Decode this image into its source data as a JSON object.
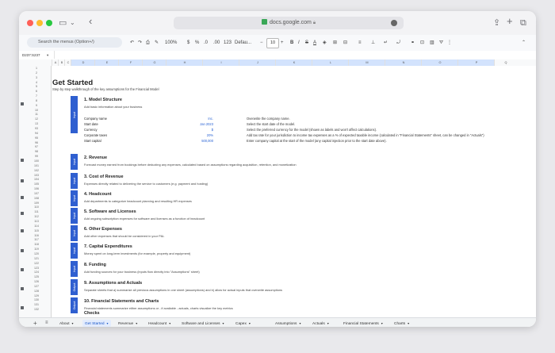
{
  "browser": {
    "url": "docs.google.com",
    "traffic_colors": {
      "close": "#ff5f57",
      "minimize": "#febc2e",
      "zoom": "#28c840"
    }
  },
  "toolbar": {
    "search_placeholder": "Search the menus (Option+/)",
    "zoom": "100%",
    "currency": "$",
    "percent": "%",
    "decimal_decrease": ".0",
    "decimal_increase": ".00",
    "number_format": "123",
    "font": "Defau...",
    "font_size": "10"
  },
  "formula_bar": {
    "name_box": "D237:S237"
  },
  "columns": [
    "A",
    "B",
    "C",
    "D",
    "E",
    "F",
    "G",
    "H",
    "I",
    "J",
    "K",
    "L",
    "M",
    "N",
    "O",
    "P",
    "Q"
  ],
  "rows": [
    "1",
    "2",
    "3",
    "4",
    "5",
    "6",
    "7",
    "8",
    "9",
    "10",
    "11",
    "12",
    "13",
    "93",
    "94",
    "95",
    "96",
    "97",
    "98",
    "99",
    "100",
    "101",
    "102",
    "103",
    "104",
    "105",
    "106",
    "107",
    "108",
    "109",
    "110",
    "111",
    "112",
    "113",
    "114",
    "115",
    "116",
    "117",
    "118",
    "119",
    "120",
    "121",
    "122",
    "123",
    "124",
    "125",
    "126",
    "127",
    "128",
    "129",
    "130",
    "131",
    "132"
  ],
  "sheet": {
    "title": "Get Started",
    "subtitle": "Step by step walkthrough of the key assumptions for the Financial Model",
    "input_tag": "Input",
    "output_tag": "Output",
    "sections": [
      {
        "title": "1. Model Structure",
        "desc": "Add basic information about your business",
        "tag": "Input"
      },
      {
        "title": "2. Revenue",
        "desc": "Forecast money earned from bookings before deducting any expenses, calculated based on assumptions regarding acquisition, retention, and monetization",
        "tag": "Input"
      },
      {
        "title": "3. Cost of Revenue",
        "desc": "Expenses directly related to delivering the service to customers (e.g. payment and hosting)",
        "tag": "Input"
      },
      {
        "title": "4. Headcount",
        "desc": "Add departments to categorize headcount planning and resulting HR expenses",
        "tag": "Input"
      },
      {
        "title": "5. Software and Licenses",
        "desc": "Add ongoing subscription expenses for software and licenses as a function of headcount",
        "tag": "Input"
      },
      {
        "title": "6. Other Expenses",
        "desc": "Add other expenses that should be considered in your P&L",
        "tag": "Input"
      },
      {
        "title": "7. Capital Expenditures",
        "desc": "Money spent on long-term investments (for example, property and equipment)",
        "tag": "Input"
      },
      {
        "title": "8. Funding",
        "desc": "Add funding sources for your business (inputs flow directly into \"Assumptions\" sheet)",
        "tag": "Input"
      },
      {
        "title": "9. Assumptions and Actuals",
        "desc": "Separate sheets that a) summarize all previous assumptions in one sheet (assumptions) and b) allow for actual inputs that overwrite assumptions",
        "tag": "Output"
      },
      {
        "title": "10. Financial Statements and Charts",
        "desc": "Financial statements summarize either assumptions or - if available - actuals, charts visualize the key metrics",
        "tag": "Output"
      }
    ],
    "model_structure": [
      {
        "label": "Company name",
        "value": "Inc.",
        "desc": "Overwrite the company name."
      },
      {
        "label": "Start date",
        "value": "Jan 2023",
        "desc": "Select the start date of the model."
      },
      {
        "label": "Currency",
        "value": "$",
        "desc": "Select the preferred currency for the model (shown as labels and won't affect calculations)."
      },
      {
        "label": "Corporate taxes",
        "value": "20%",
        "desc": "Add tax rate for your jurisdiction to income tax expenses as a % of expected taxable income (calculated in \"Financial Statements\" sheet, can be changed in \"Actuals\")"
      },
      {
        "label": "Start capital",
        "value": "500,000",
        "desc": "Enter company capital at the start of the model (any capital injection prior to the start date above)."
      }
    ],
    "checks_title": "Checks"
  },
  "tabs": [
    "About",
    "Get Started",
    "Revenue",
    "Headcount",
    "Software and Licenses",
    "Capex",
    "Assumptions",
    "Actuals",
    "Financial Statements",
    "Charts"
  ],
  "active_tab": "Get Started",
  "colors": {
    "accent": "#2f5fd0",
    "value_blue": "#2a63d4",
    "active_tab_bg": "#e3ecfd"
  }
}
